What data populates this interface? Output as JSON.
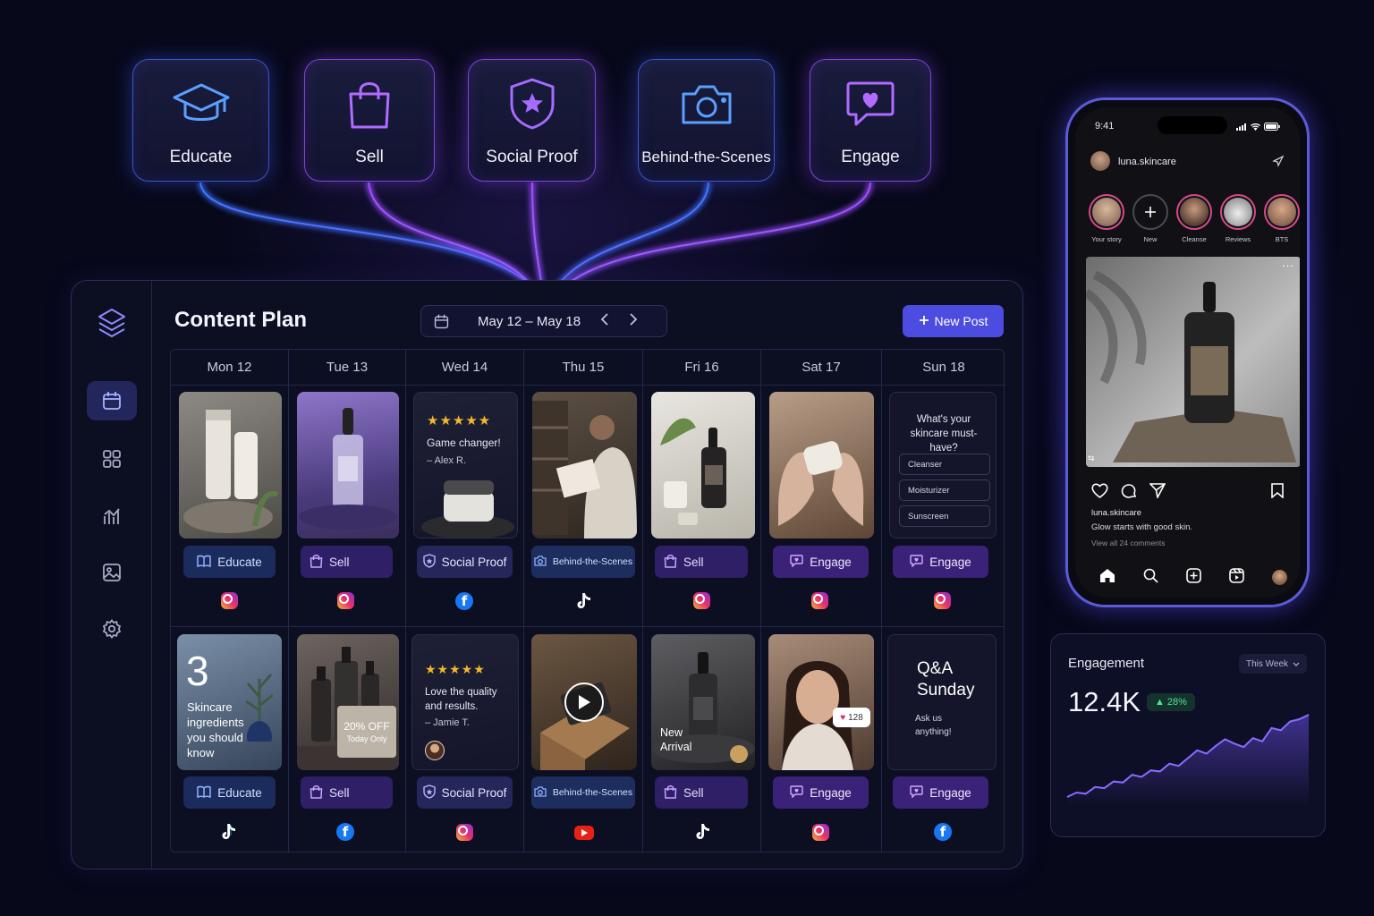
{
  "pillars": [
    {
      "label": "Educate",
      "icon": "graduation-cap-icon",
      "style": "blue"
    },
    {
      "label": "Sell",
      "icon": "shopping-bag-icon",
      "style": "purple"
    },
    {
      "label": "Social Proof",
      "icon": "shield-star-icon",
      "style": "purple"
    },
    {
      "label": "Behind-the-Scenes",
      "icon": "camera-icon",
      "style": "blue"
    },
    {
      "label": "Engage",
      "icon": "chat-heart-icon",
      "style": "purple"
    }
  ],
  "planner": {
    "title": "Content Plan",
    "date_range": "May 12 – May 18",
    "new_post_label": "New Post",
    "sidebar": [
      "layers-icon",
      "calendar-icon",
      "grid-icon",
      "analytics-icon",
      "image-icon",
      "settings-icon"
    ],
    "days": [
      "Mon 12",
      "Tue 13",
      "Wed 14",
      "Thu 15",
      "Fri 16",
      "Sat 17",
      "Sun 18"
    ],
    "week1": [
      {
        "tag": "Educate",
        "platform": "instagram"
      },
      {
        "tag": "Sell",
        "platform": "instagram"
      },
      {
        "tag": "Social Proof",
        "platform": "facebook",
        "stars": "★★★★★",
        "quote": "Game changer!",
        "author": "– Alex R."
      },
      {
        "tag": "Behind-the-Scenes",
        "platform": "tiktok"
      },
      {
        "tag": "Sell",
        "platform": "instagram"
      },
      {
        "tag": "Engage",
        "platform": "instagram"
      },
      {
        "tag": "Engage",
        "platform": "instagram",
        "question": "What's your skincare must-have?",
        "options": [
          "Cleanser",
          "Moisturizer",
          "Sunscreen"
        ]
      }
    ],
    "week2": [
      {
        "tag": "Educate",
        "platform": "tiktok",
        "big_number": "3",
        "text": "Skincare ingredients you should know"
      },
      {
        "tag": "Sell",
        "platform": "facebook",
        "offer": "20% OFF",
        "offer_sub": "Today Only"
      },
      {
        "tag": "Social Proof",
        "platform": "instagram",
        "stars": "★★★★★",
        "quote": "Love the quality and results.",
        "author": "– Jamie T."
      },
      {
        "tag": "Behind-the-Scenes",
        "platform": "youtube"
      },
      {
        "tag": "Sell",
        "platform": "tiktok",
        "text": "New Arrival"
      },
      {
        "tag": "Engage",
        "platform": "instagram",
        "likes": "128"
      },
      {
        "tag": "Engage",
        "platform": "facebook",
        "title": "Q&A Sunday",
        "sub": "Ask us anything!"
      }
    ]
  },
  "phone": {
    "time": "9:41",
    "handle": "luna.skincare",
    "stories": [
      "Your story",
      "New",
      "Cleanse",
      "Reviews",
      "BTS"
    ],
    "caption_user": "luna.skincare",
    "caption": "Glow starts with good skin.",
    "comments": "View all 24 comments"
  },
  "engagement": {
    "label": "Engagement",
    "period": "This Week",
    "value": "12.4K",
    "change": "28%",
    "accent": "#6b4de6",
    "trend": [
      10,
      14,
      13,
      19,
      18,
      24,
      23,
      30,
      28,
      34,
      33,
      40,
      38,
      45,
      52,
      49,
      56,
      62,
      58,
      55,
      63,
      60,
      72,
      70,
      78,
      80,
      84
    ]
  },
  "colors": {
    "accent": "#4c4ce0",
    "background": "#07081a",
    "glow_blue": "#3a6cff",
    "glow_purple": "#9a4dff"
  }
}
